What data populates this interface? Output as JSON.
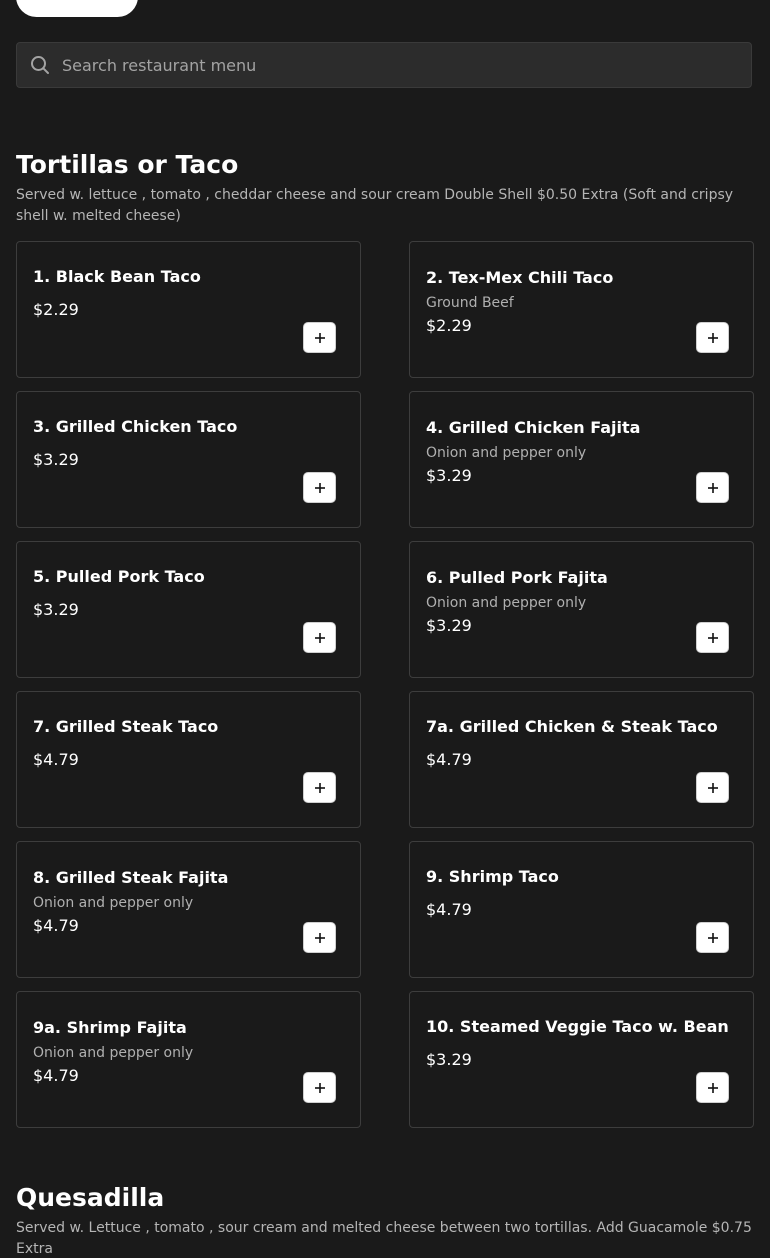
{
  "search": {
    "placeholder": "Search restaurant menu"
  },
  "sections": [
    {
      "title": "Tortillas or Taco",
      "description": "Served w. lettuce , tomato , cheddar cheese and sour cream Double Shell $0.50 Extra (Soft and cripsy shell w. melted cheese)",
      "items": [
        {
          "name": "1. Black Bean Taco",
          "description": "",
          "price": "$2.29"
        },
        {
          "name": "2. Tex-Mex Chili Taco",
          "description": "Ground Beef",
          "price": "$2.29"
        },
        {
          "name": "3. Grilled Chicken Taco",
          "description": "",
          "price": "$3.29"
        },
        {
          "name": "4. Grilled Chicken Fajita",
          "description": "Onion and pepper only",
          "price": "$3.29"
        },
        {
          "name": "5. Pulled Pork Taco",
          "description": "",
          "price": "$3.29"
        },
        {
          "name": "6. Pulled Pork Fajita",
          "description": "Onion and pepper only",
          "price": "$3.29"
        },
        {
          "name": "7. Grilled Steak Taco",
          "description": "",
          "price": "$4.79"
        },
        {
          "name": "7a. Grilled Chicken & Steak Taco",
          "description": "",
          "price": "$4.79"
        },
        {
          "name": "8. Grilled Steak Fajita",
          "description": "Onion and pepper only",
          "price": "$4.79"
        },
        {
          "name": "9. Shrimp Taco",
          "description": "",
          "price": "$4.79"
        },
        {
          "name": "9a. Shrimp Fajita",
          "description": "Onion and pepper only",
          "price": "$4.79"
        },
        {
          "name": "10. Steamed Veggie Taco w. Bean",
          "description": "",
          "price": "$3.29"
        }
      ]
    },
    {
      "title": "Quesadilla",
      "description": "Served w. Lettuce , tomato , sour cream and melted cheese between two tortillas. Add Guacamole $0.75 Extra"
    }
  ],
  "icons": {
    "search": "search-icon",
    "add": "plus-icon"
  },
  "colors": {
    "background": "#1a1a1a",
    "card_border": "#3d3d3d",
    "search_bg": "#2c2c2c",
    "button_bg": "#ffffff"
  }
}
